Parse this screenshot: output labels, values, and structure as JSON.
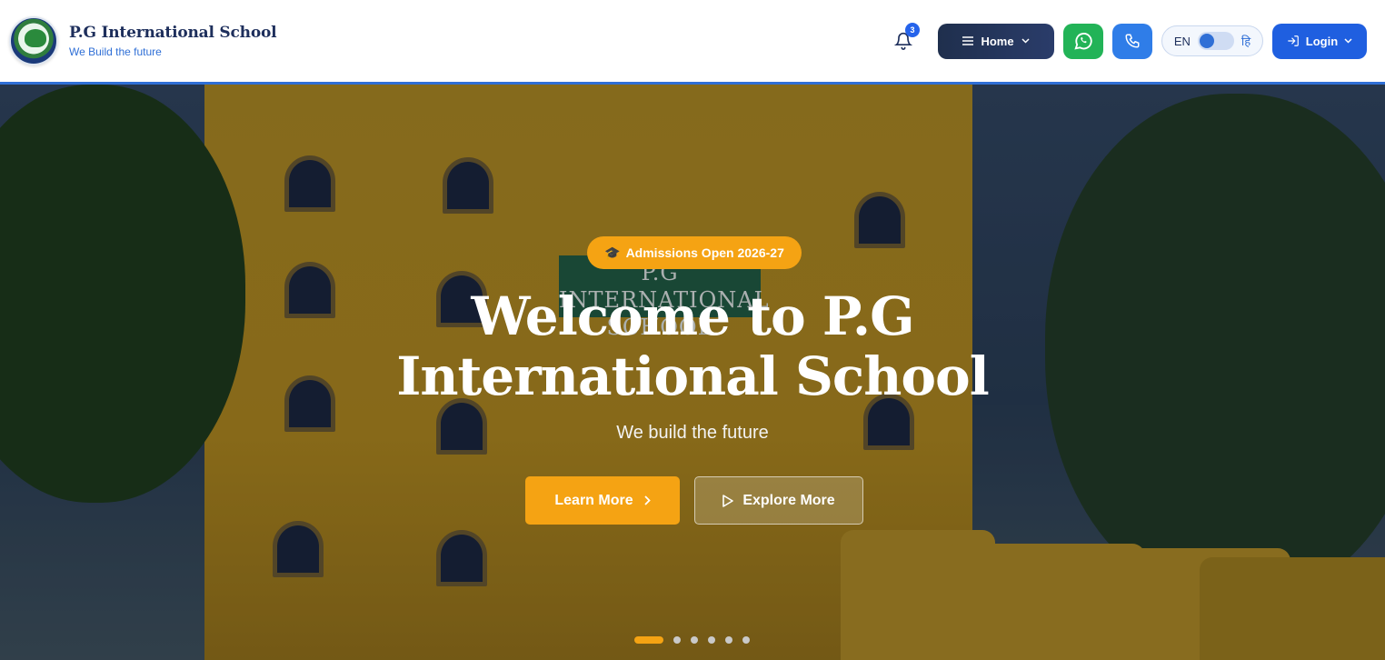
{
  "brand": {
    "title": "P.G International School",
    "tagline": "We Build the future"
  },
  "header": {
    "notification_count": "3",
    "home_label": "Home",
    "lang_en": "EN",
    "lang_hi": "हि",
    "login_label": "Login"
  },
  "hero": {
    "badge": "Admissions Open 2026-27",
    "title_line1": "Welcome to P.G",
    "title_line2": "International School",
    "subtitle": "We build the future",
    "learn_more": "Learn More",
    "explore_more": "Explore More",
    "sign_line1": "P.G INTERNATIONAL",
    "sign_line2": "SCHOOL",
    "slides_total": 6,
    "active_slide": 1
  },
  "colors": {
    "accent": "#f5a313",
    "brand_blue": "#1f5fe0",
    "whatsapp": "#22b357"
  }
}
